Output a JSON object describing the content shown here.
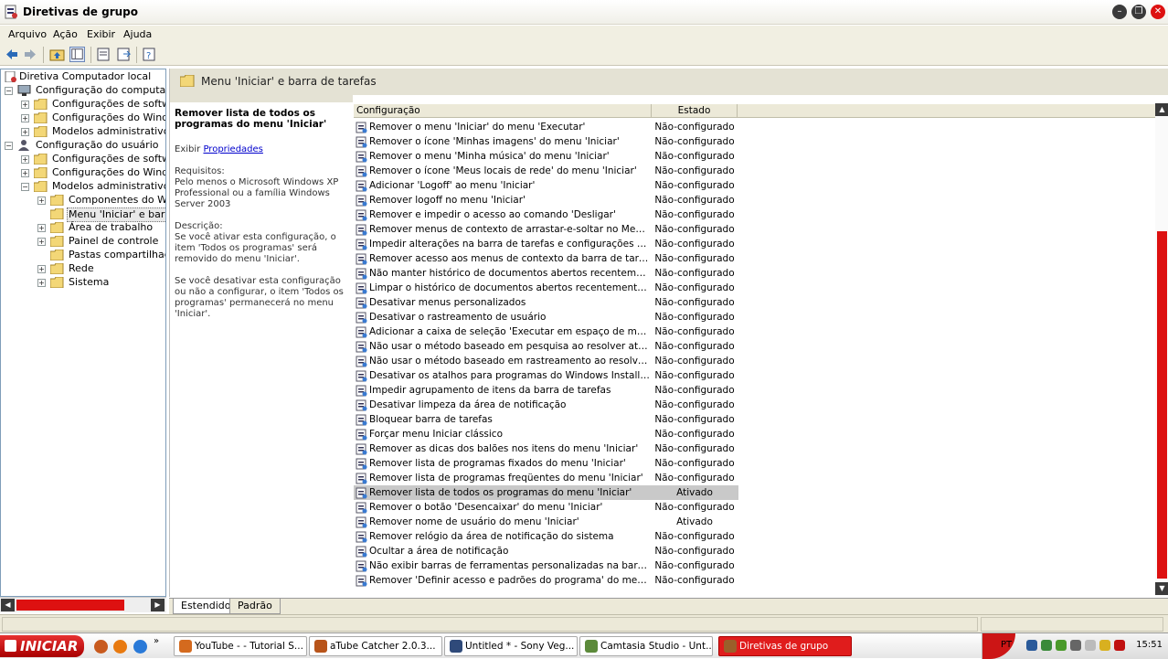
{
  "window": {
    "title": "Diretivas de grupo"
  },
  "menu": [
    "Arquivo",
    "Ação",
    "Exibir",
    "Ajuda"
  ],
  "toolbar_icons": [
    "back-arrow-icon",
    "forward-arrow-icon",
    "up-folder-icon",
    "show-hide-tree-icon",
    "properties-icon",
    "export-list-icon",
    "help-icon"
  ],
  "tree": {
    "root": "Diretiva Computador local",
    "computer_config": "Configuração do computador",
    "cc_software": "Configurações de software",
    "cc_windows": "Configurações do Windows",
    "cc_admin": "Modelos administrativos",
    "user_config": "Configuração do usuário",
    "uc_software": "Configurações de software",
    "uc_windows": "Configurações do Windows",
    "uc_admin": "Modelos administrativos",
    "components": "Componentes do Windows",
    "start_menu": "Menu 'Iniciar' e barra de tarefas",
    "desktop": "Área de trabalho",
    "control_panel": "Painel de controle",
    "shared_folders": "Pastas compartilhadas",
    "network": "Rede",
    "system": "Sistema"
  },
  "content_header": "Menu 'Iniciar' e barra de tarefas",
  "description": {
    "title": "Remover lista de todos os programas do menu 'Iniciar'",
    "show_label": "Exibir",
    "show_link": "Propriedades",
    "req_label": "Requisitos:",
    "req_text": "Pelo menos o Microsoft Windows XP Professional ou a família Windows Server 2003",
    "desc_label": "Descrição:",
    "desc_p1": "Se você ativar esta configuração, o item 'Todos os programas' será removido do menu 'Iniciar'.",
    "desc_p2": "Se você desativar esta configuração ou não a configurar, o item 'Todos os programas' permanecerá no menu 'Iniciar'."
  },
  "list": {
    "col_config": "Configuração",
    "col_state": "Estado",
    "rows": [
      {
        "name": "Remover o menu 'Iniciar' do menu 'Executar'",
        "state": "Não-configurado"
      },
      {
        "name": "Remover o ícone 'Minhas imagens' do menu 'Iniciar'",
        "state": "Não-configurado"
      },
      {
        "name": "Remover o menu 'Minha música' do menu 'Iniciar'",
        "state": "Não-configurado"
      },
      {
        "name": "Remover o ícone 'Meus locais de rede' do menu 'Iniciar'",
        "state": "Não-configurado"
      },
      {
        "name": "Adicionar 'Logoff' ao menu 'Iniciar'",
        "state": "Não-configurado"
      },
      {
        "name": "Remover logoff no menu 'Iniciar'",
        "state": "Não-configurado"
      },
      {
        "name": "Remover e impedir o acesso ao comando 'Desligar'",
        "state": "Não-configurado"
      },
      {
        "name": "Remover menus de contexto de arrastar-e-soltar no Menu 'Iniciar'",
        "state": "Não-configurado"
      },
      {
        "name": "Impedir alterações na barra de tarefas e configurações do menu '...",
        "state": "Não-configurado"
      },
      {
        "name": "Remover acesso aos menus de contexto da barra de tarefas",
        "state": "Não-configurado"
      },
      {
        "name": "Não manter histórico de documentos abertos recentemente",
        "state": "Não-configurado"
      },
      {
        "name": "Limpar o histórico de documentos abertos recentemente ao sair",
        "state": "Não-configurado"
      },
      {
        "name": "Desativar menus personalizados",
        "state": "Não-configurado"
      },
      {
        "name": "Desativar o rastreamento de usuário",
        "state": "Não-configurado"
      },
      {
        "name": "Adicionar a caixa de seleção 'Executar em espaço de memória sep...",
        "state": "Não-configurado"
      },
      {
        "name": "Não usar o método baseado em pesquisa ao resolver atalhos do s...",
        "state": "Não-configurado"
      },
      {
        "name": "Não usar o método baseado em rastreamento ao resolver atalhos...",
        "state": "Não-configurado"
      },
      {
        "name": "Desativar os atalhos para programas do Windows Installer no me...",
        "state": "Não-configurado"
      },
      {
        "name": "Impedir agrupamento de itens da barra de tarefas",
        "state": "Não-configurado"
      },
      {
        "name": "Desativar limpeza da área de notificação",
        "state": "Não-configurado"
      },
      {
        "name": "Bloquear barra de tarefas",
        "state": "Não-configurado"
      },
      {
        "name": "Forçar menu Iniciar clássico",
        "state": "Não-configurado"
      },
      {
        "name": "Remover as dicas dos balões nos itens do menu 'Iniciar'",
        "state": "Não-configurado"
      },
      {
        "name": "Remover lista de programas fixados do menu 'Iniciar'",
        "state": "Não-configurado"
      },
      {
        "name": "Remover lista de programas freqüentes do menu 'Iniciar'",
        "state": "Não-configurado"
      },
      {
        "name": "Remover lista de todos os programas do menu 'Iniciar'",
        "state": "Ativado",
        "selected": true
      },
      {
        "name": "Remover o botão 'Desencaixar' do menu 'Iniciar'",
        "state": "Não-configurado"
      },
      {
        "name": "Remover nome de usuário do menu 'Iniciar'",
        "state": "Ativado"
      },
      {
        "name": "Remover relógio da área de notificação do sistema",
        "state": "Não-configurado"
      },
      {
        "name": "Ocultar a área de notificação",
        "state": "Não-configurado"
      },
      {
        "name": "Não exibir barras de ferramentas personalizadas na barra de tare...",
        "state": "Não-configurado"
      },
      {
        "name": "Remover 'Definir acesso e padrões do programa' do menu 'Iniciar'",
        "state": "Não-configurado"
      }
    ]
  },
  "tabs": [
    "Estendido",
    "Padrão"
  ],
  "taskbar": {
    "start": "INICIAR",
    "buttons": [
      {
        "label": "YouTube - - Tutorial S...",
        "color": "#d46a1e"
      },
      {
        "label": "aTube Catcher 2.0.3...",
        "color": "#b8541a"
      },
      {
        "label": "Untitled * - Sony Veg...",
        "color": "#2f4a7a"
      },
      {
        "label": "Camtasia Studio - Unt...",
        "color": "#5c8a3a"
      },
      {
        "label": "Diretivas de grupo",
        "color": "#9b5f2a",
        "active": true
      }
    ],
    "lang": "PT",
    "clock": "15:51"
  },
  "colors": {
    "accent_red": "#dd1111",
    "selection_gray": "#c9c9c9"
  }
}
